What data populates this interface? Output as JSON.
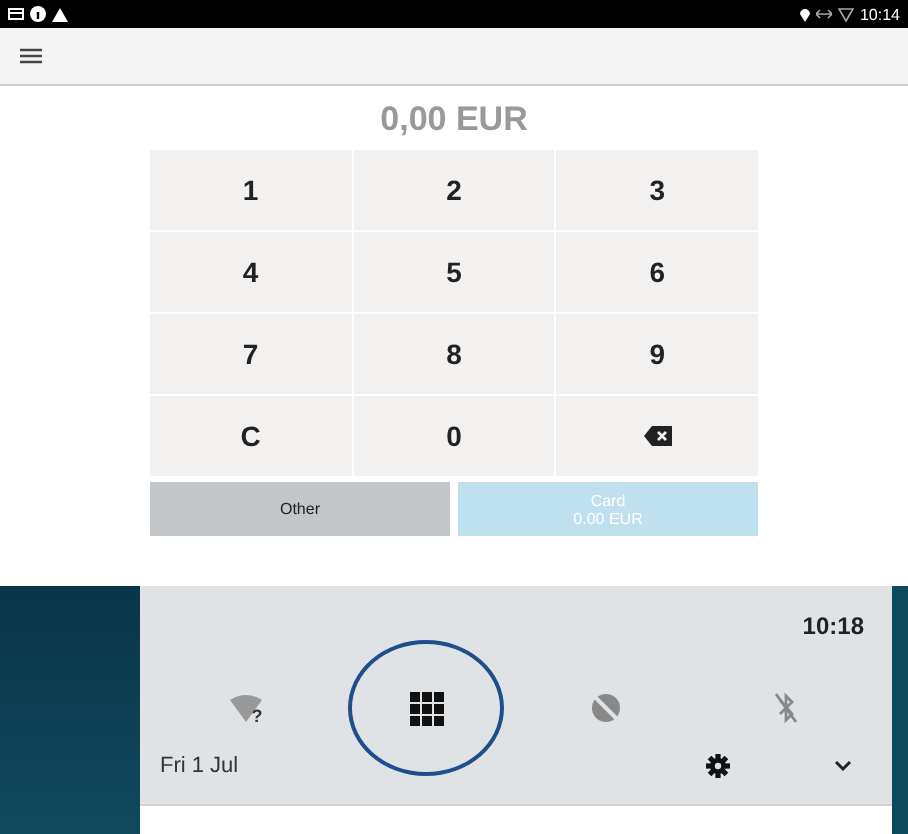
{
  "status_bar": {
    "time": "10:14"
  },
  "amount": "0,00 EUR",
  "keys": [
    {
      "kind": "digit",
      "label": "1"
    },
    {
      "kind": "digit",
      "label": "2"
    },
    {
      "kind": "digit",
      "label": "3"
    },
    {
      "kind": "digit",
      "label": "4"
    },
    {
      "kind": "digit",
      "label": "5"
    },
    {
      "kind": "digit",
      "label": "6"
    },
    {
      "kind": "digit",
      "label": "7"
    },
    {
      "kind": "digit",
      "label": "8"
    },
    {
      "kind": "digit",
      "label": "9"
    },
    {
      "kind": "digit",
      "label": "C"
    },
    {
      "kind": "digit",
      "label": "0"
    },
    {
      "kind": "backspace"
    }
  ],
  "payment_buttons": [
    {
      "label": "Other",
      "disabled": false
    },
    {
      "label": "Card",
      "amount": "0.00 EUR",
      "disabled": true
    }
  ],
  "quick_settings": {
    "time": "10:18",
    "date": "Fri 1 Jul",
    "tiles": [
      {
        "kind": "wifi",
        "circled": false,
        "badge": "?"
      },
      {
        "kind": "grid",
        "circled": true
      },
      {
        "kind": "data-saver",
        "circled": false
      },
      {
        "kind": "bluetooth-off",
        "circled": false
      }
    ]
  }
}
